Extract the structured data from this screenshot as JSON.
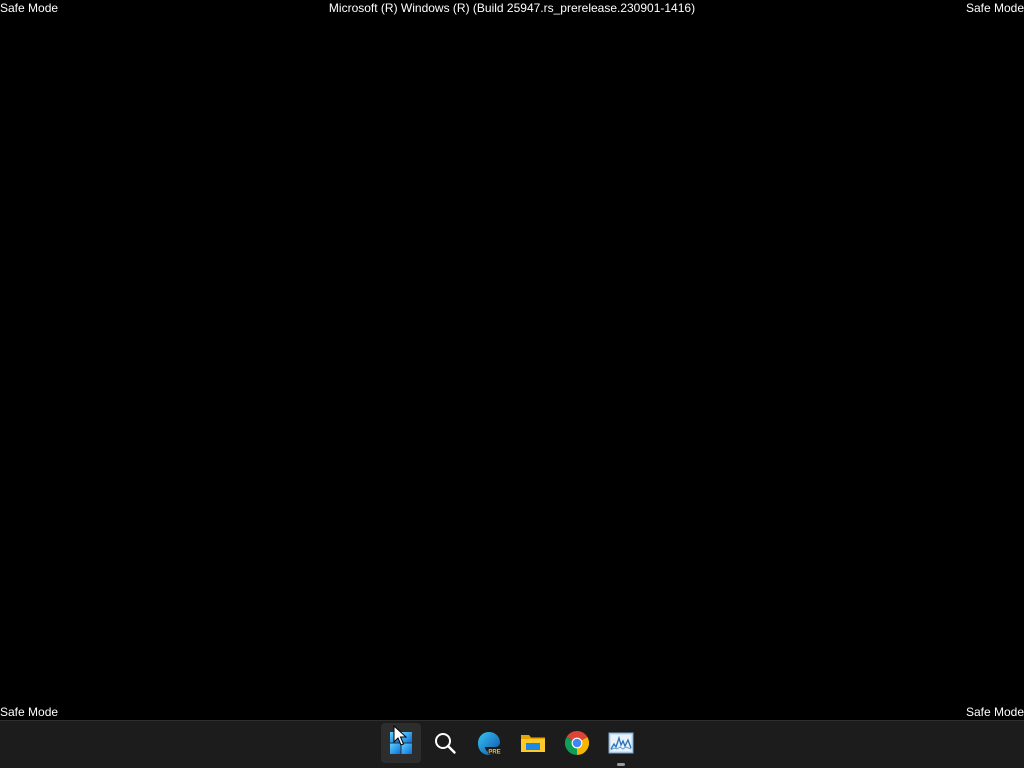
{
  "desktop": {
    "watermark_top_left": "Safe Mode",
    "watermark_top_right": "Safe Mode",
    "watermark_bottom_left": "Safe Mode",
    "watermark_bottom_right": "Safe Mode",
    "build_string": "Microsoft (R) Windows (R) (Build 25947.rs_prerelease.230901-1416)"
  },
  "taskbar": {
    "items": [
      {
        "icon": "windows-start-icon",
        "state": "hover"
      },
      {
        "icon": "search-icon"
      },
      {
        "icon": "edge-preview-icon",
        "badge": "PRE"
      },
      {
        "icon": "file-explorer-icon"
      },
      {
        "icon": "chrome-icon"
      },
      {
        "icon": "resource-monitor-icon",
        "running": true
      }
    ]
  },
  "colors": {
    "desktop_bg": "#000000",
    "taskbar_bg": "#1c1c1c",
    "text": "#ffffff",
    "accent": "#0078d4"
  }
}
